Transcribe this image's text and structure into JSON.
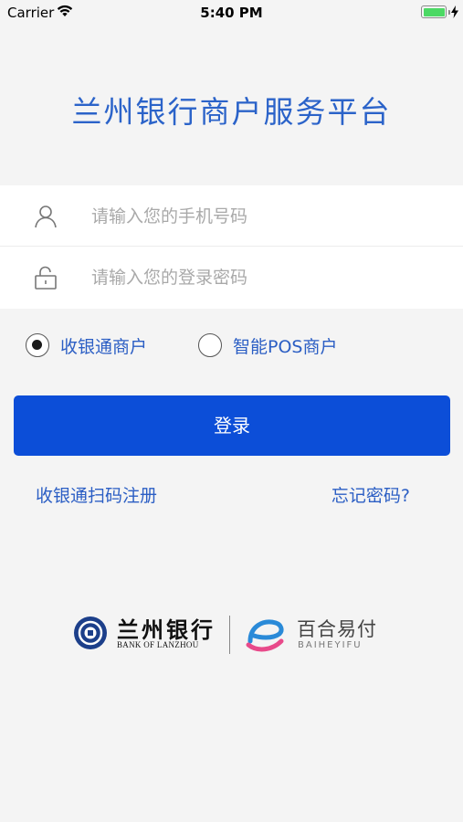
{
  "status_bar": {
    "carrier": "Carrier",
    "time": "5:40 PM"
  },
  "app": {
    "title": "兰州银行商户服务平台"
  },
  "form": {
    "phone_placeholder": "请输入您的手机号码",
    "phone_value": "",
    "password_placeholder": "请输入您的登录密码",
    "password_value": ""
  },
  "merchant_type": {
    "options": [
      {
        "label": "收银通商户",
        "selected": true
      },
      {
        "label": "智能POS商户",
        "selected": false
      }
    ]
  },
  "actions": {
    "login_label": "登录",
    "register_label": "收银通扫码注册",
    "forgot_label": "忘记密码?"
  },
  "footer": {
    "bank_name": "兰州银行",
    "bank_name_en": "BANK OF LANZHOU",
    "partner_name": "百合易付",
    "partner_name_en": "BAIHEYIFU"
  },
  "colors": {
    "primary": "#0c4ed8",
    "link": "#2b5ec4",
    "background": "#f4f4f4",
    "battery": "#4cd964"
  }
}
